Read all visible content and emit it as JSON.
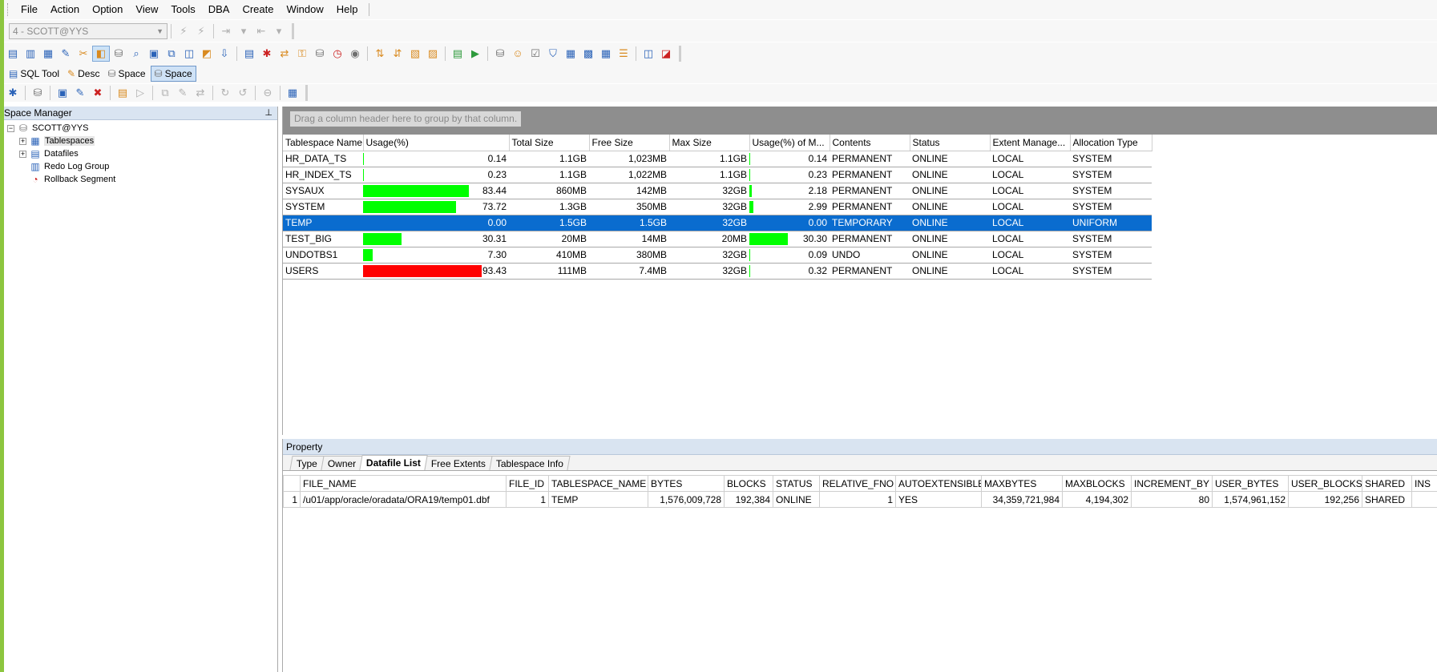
{
  "menu": [
    "File",
    "Action",
    "Option",
    "View",
    "Tools",
    "DBA",
    "Create",
    "Window",
    "Help"
  ],
  "connection": {
    "value": "4 - SCOTT@YYS"
  },
  "toolbar_tabs": [
    {
      "label": "SQL Tool",
      "icon": "sql-tool-icon"
    },
    {
      "label": "Desc",
      "icon": "desc-icon"
    },
    {
      "label": "Space",
      "icon": "space-icon"
    },
    {
      "label": "Space",
      "icon": "space-icon",
      "active": true
    }
  ],
  "space_manager": {
    "title": "Space Manager",
    "root": "SCOTT@YYS",
    "nodes": [
      "Tablespaces",
      "Datafiles",
      "Redo Log Group",
      "Rollback Segment"
    ]
  },
  "grid": {
    "group_hint": "Drag a column header here to group by that column.",
    "columns": [
      "Tablespace Name",
      "Usage(%)",
      "Total Size",
      "Free Size",
      "Max Size",
      "Usage(%) of M...",
      "Contents",
      "Status",
      "Extent Manage...",
      "Allocation Type"
    ],
    "rows": [
      {
        "name": "HR_DATA_TS",
        "usage": "0.14",
        "usage_pct": 0.14,
        "total": "1.1GB",
        "free": "1,023MB",
        "max": "1.1GB",
        "usage_max": "0.14",
        "usage_max_pct": 0.14,
        "contents": "PERMANENT",
        "status": "ONLINE",
        "extent": "LOCAL",
        "alloc": "SYSTEM"
      },
      {
        "name": "HR_INDEX_TS",
        "usage": "0.23",
        "usage_pct": 0.23,
        "total": "1.1GB",
        "free": "1,022MB",
        "max": "1.1GB",
        "usage_max": "0.23",
        "usage_max_pct": 0.23,
        "contents": "PERMANENT",
        "status": "ONLINE",
        "extent": "LOCAL",
        "alloc": "SYSTEM"
      },
      {
        "name": "SYSAUX",
        "usage": "83.44",
        "usage_pct": 83.44,
        "total": "860MB",
        "free": "142MB",
        "max": "32GB",
        "usage_max": "2.18",
        "usage_max_pct": 2.18,
        "contents": "PERMANENT",
        "status": "ONLINE",
        "extent": "LOCAL",
        "alloc": "SYSTEM"
      },
      {
        "name": "SYSTEM",
        "usage": "73.72",
        "usage_pct": 73.72,
        "total": "1.3GB",
        "free": "350MB",
        "max": "32GB",
        "usage_max": "2.99",
        "usage_max_pct": 2.99,
        "contents": "PERMANENT",
        "status": "ONLINE",
        "extent": "LOCAL",
        "alloc": "SYSTEM"
      },
      {
        "name": "TEMP",
        "usage": "0.00",
        "usage_pct": 0,
        "total": "1.5GB",
        "free": "1.5GB",
        "max": "32GB",
        "usage_max": "0.00",
        "usage_max_pct": 0,
        "contents": "TEMPORARY",
        "status": "ONLINE",
        "extent": "LOCAL",
        "alloc": "UNIFORM",
        "selected": true
      },
      {
        "name": "TEST_BIG",
        "usage": "30.31",
        "usage_pct": 30.31,
        "total": "20MB",
        "free": "14MB",
        "max": "20MB",
        "usage_max": "30.30",
        "usage_max_pct": 30.3,
        "contents": "PERMANENT",
        "status": "ONLINE",
        "extent": "LOCAL",
        "alloc": "SYSTEM"
      },
      {
        "name": "UNDOTBS1",
        "usage": "7.30",
        "usage_pct": 7.3,
        "total": "410MB",
        "free": "380MB",
        "max": "32GB",
        "usage_max": "0.09",
        "usage_max_pct": 0.09,
        "contents": "UNDO",
        "status": "ONLINE",
        "extent": "LOCAL",
        "alloc": "SYSTEM"
      },
      {
        "name": "USERS",
        "usage": "93.43",
        "usage_pct": 93.43,
        "total": "111MB",
        "free": "7.4MB",
        "max": "32GB",
        "usage_max": "0.32",
        "usage_max_pct": 0.32,
        "contents": "PERMANENT",
        "status": "ONLINE",
        "extent": "LOCAL",
        "alloc": "SYSTEM"
      }
    ]
  },
  "colors": {
    "bar_normal": "#00ff00",
    "bar_alert": "#ff0000",
    "selection": "#0a6ccf",
    "alert_threshold_pct": 90
  },
  "property": {
    "title": "Property",
    "tabs": [
      "Type",
      "Owner",
      "Datafile List",
      "Free Extents",
      "Tablespace Info"
    ],
    "active_tab": "Datafile List",
    "columns": [
      "",
      "FILE_NAME",
      "FILE_ID",
      "TABLESPACE_NAME",
      "BYTES",
      "BLOCKS",
      "STATUS",
      "RELATIVE_FNO",
      "AUTOEXTENSIBLE",
      "MAXBYTES",
      "MAXBLOCKS",
      "INCREMENT_BY",
      "USER_BYTES",
      "USER_BLOCKS",
      "SHARED",
      "INS"
    ],
    "rows": [
      [
        "1",
        "/u01/app/oracle/oradata/ORA19/temp01.dbf",
        "1",
        "TEMP",
        "1,576,009,728",
        "192,384",
        "ONLINE",
        "1",
        "YES",
        "34,359,721,984",
        "4,194,302",
        "80",
        "1,574,961,152",
        "192,256",
        "SHARED",
        ""
      ]
    ]
  }
}
